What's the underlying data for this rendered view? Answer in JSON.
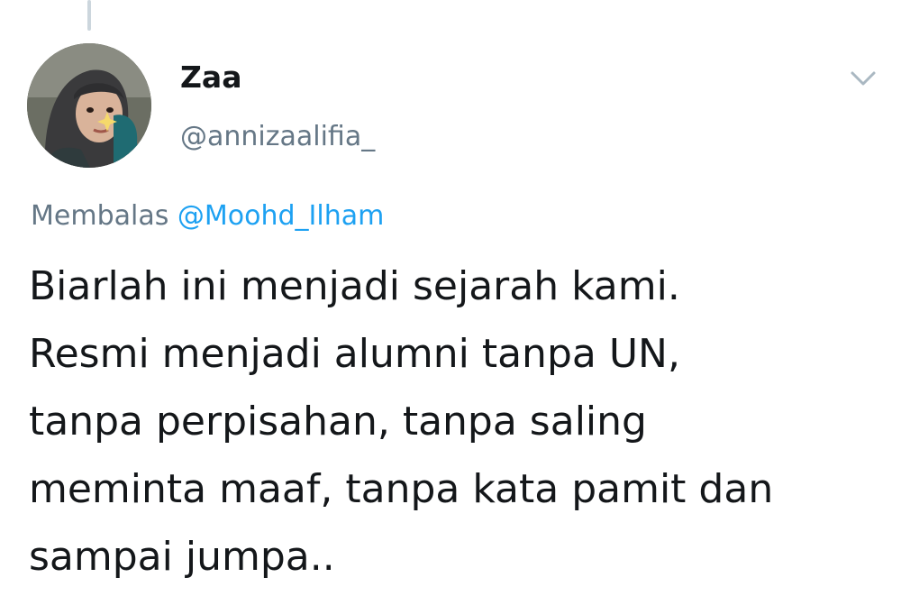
{
  "tweet": {
    "display_name": "Zaa",
    "handle": "@annizaalifia_",
    "reply_prefix": "Membalas",
    "reply_mention": "@Moohd_Ilham",
    "text_lines": [
      "Biarlah ini menjadi sejarah kami.",
      "Resmi menjadi alumni tanpa UN,",
      "tanpa perpisahan, tanpa saling",
      "meminta maaf, tanpa kata pamit dan",
      "sampai jumpa.."
    ]
  },
  "icons": {
    "more_menu": "chevron-down-icon",
    "avatar": "profile-photo"
  },
  "colors": {
    "primary_text": "#14171a",
    "secondary_text": "#657786",
    "link": "#1da1f2",
    "thread_line": "#ccd6dd",
    "background": "#ffffff"
  }
}
